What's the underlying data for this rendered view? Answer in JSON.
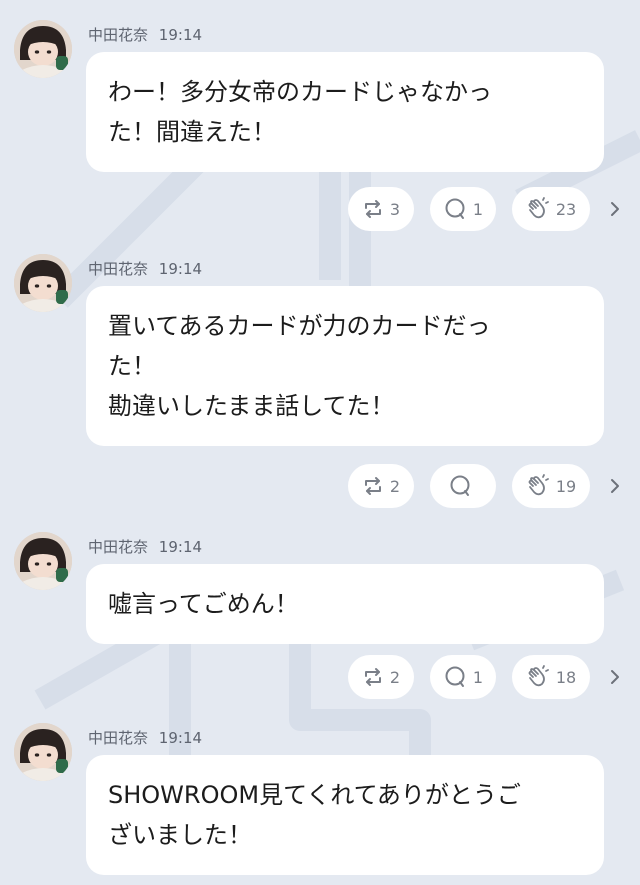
{
  "posts": [
    {
      "author": "中田花奈",
      "time": "19:14",
      "text": "わー！多分女帝のカードじゃなかっ\nた！間違えた！",
      "reposts": "3",
      "comments": "1",
      "claps": "23"
    },
    {
      "author": "中田花奈",
      "time": "19:14",
      "text": "置いてあるカードが力のカードだっ\nた！\n勘違いしたまま話してた！",
      "reposts": "2",
      "comments": "",
      "claps": "19"
    },
    {
      "author": "中田花奈",
      "time": "19:14",
      "text": "嘘言ってごめん！",
      "reposts": "2",
      "comments": "1",
      "claps": "18"
    },
    {
      "author": "中田花奈",
      "time": "19:14",
      "text": "SHOWROOM見てくれてありがとうご\nざいました！",
      "reposts": "",
      "comments": "",
      "claps": ""
    }
  ],
  "icons": {
    "repost": "repost-icon",
    "comment": "comment-icon",
    "clap": "clap-icon",
    "more": "chevron-right-icon",
    "avatar": "avatar"
  }
}
